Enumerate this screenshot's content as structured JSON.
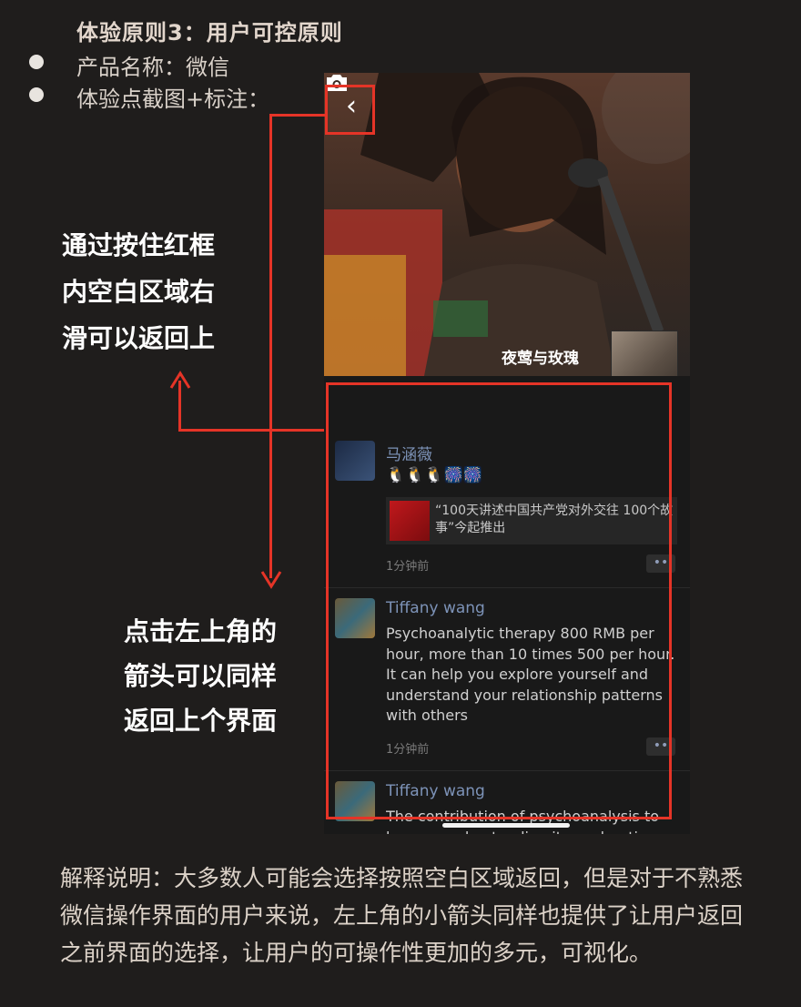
{
  "slide": {
    "title": "体验原则3：用户可控原则",
    "product_line": "产品名称：微信",
    "screenshot_line": "体验点截图+标注："
  },
  "annotations": {
    "swipe_note": [
      "通过按住红框",
      "内空白区域右",
      "滑可以返回上"
    ],
    "arrow_note": [
      "点击左上角的",
      "箭头可以同样",
      "返回上个界面"
    ]
  },
  "explanation": "解释说明：大多数人可能会选择按照空白区域返回，但是对于不熟悉微信操作界面的用户来说，左上角的小箭头同样也提供了让用户返回之前界面的选择，让用户的可操作性更加的多元，可视化。",
  "phone": {
    "cover": {
      "back_icon": "‹",
      "camera_icon": "camera-icon",
      "caption": "夜莺与玫瑰"
    },
    "posts": [
      {
        "name": "马涵薇",
        "emoji": "🐧🐧🐧🎆🎆",
        "share_text": "“100天讲述中国共产党对外交往 100个故事”今起推出",
        "time": "1分钟前",
        "more": "••"
      },
      {
        "name": "Tiffany wang",
        "text": "Psychoanalytic therapy 800 RMB per hour, more than 10 times 500 per hour. It can help you explore yourself and understand your relationship patterns with others",
        "time": "1分钟前",
        "more": "••"
      },
      {
        "name": "Tiffany wang",
        "text": "The contribution of psychoanalysis to human understanding its exploration"
      }
    ]
  },
  "colors": {
    "annotation_red": "#e53427",
    "link_blue": "#7d93b8",
    "background": "#1f1d1c"
  }
}
